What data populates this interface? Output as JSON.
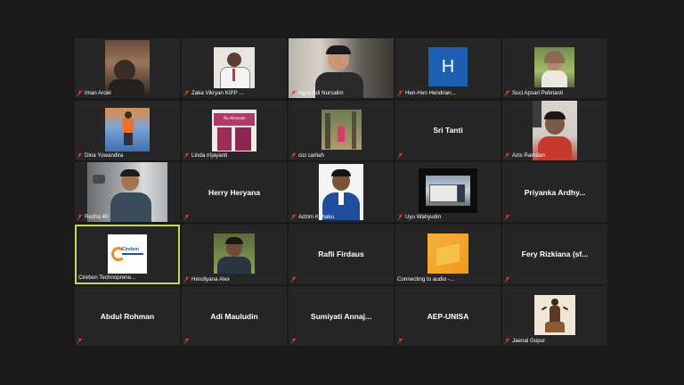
{
  "participants": [
    {
      "name": "Iman Aroel"
    },
    {
      "name": "Zaka Vikryan KIPP ..."
    },
    {
      "name": "Agus Adi Nursalim"
    },
    {
      "name": "Hen-Hen Hendrian...",
      "avatar_letter": "H"
    },
    {
      "name": "Suci Apsari Pebrianti"
    },
    {
      "name": "Dina Yuwandira"
    },
    {
      "name": "Linda rrijayanti",
      "product_text": "Nu Almonds"
    },
    {
      "name": "cici carliah"
    },
    {
      "name": "Sri Tanti"
    },
    {
      "name": "Azis Ramdan"
    },
    {
      "name": "Rezha 40"
    },
    {
      "name": "Herry Heryana"
    },
    {
      "name": "Adzim Kuhaku"
    },
    {
      "name": "Uyu Wahyudin"
    },
    {
      "name": "Priyanka  Ardhy..."
    },
    {
      "name": "Cirebon Technoprene...",
      "logo_text": "Cirebon"
    },
    {
      "name": "Hendiyana Alex"
    },
    {
      "name": "Rafli Firdaus"
    },
    {
      "name": "Connecting to audio -..."
    },
    {
      "name": "Fery  Rizkiana  (sf..."
    },
    {
      "name": "Abdul Rohman"
    },
    {
      "name": "Adi Mauludin"
    },
    {
      "name": "Sumiyati  Annaj..."
    },
    {
      "name": "AEP-UNISA"
    },
    {
      "name": "Jaenal Gopur"
    }
  ],
  "colors": {
    "background": "#1a1a1a",
    "tile": "#262626",
    "active_border": "#c8d65a",
    "muted_icon": "#e23a3a"
  }
}
